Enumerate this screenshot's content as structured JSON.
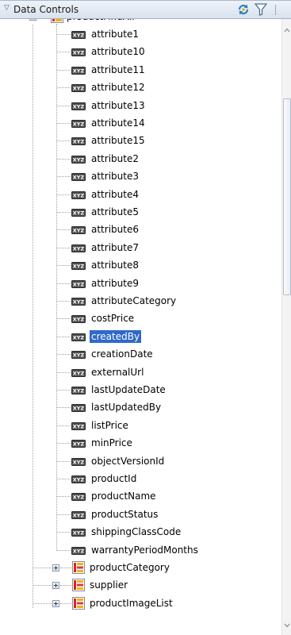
{
  "panel": {
    "title": "Data Controls"
  },
  "colors": {
    "selection": "#3069c8",
    "header": "#d9e2ee"
  },
  "icons": {
    "expand": "triangle-down-icon",
    "refresh": "refresh-icon",
    "filter": "filter-icon",
    "collection": "collection-icon",
    "attribute": "attribute-icon"
  },
  "attr_icon_text": "XYZ",
  "tree": {
    "root": {
      "label": "productFindAll",
      "expanded": true
    },
    "attributes": [
      "attribute1",
      "attribute10",
      "attribute11",
      "attribute12",
      "attribute13",
      "attribute14",
      "attribute15",
      "attribute2",
      "attribute3",
      "attribute4",
      "attribute5",
      "attribute6",
      "attribute7",
      "attribute8",
      "attribute9",
      "attributeCategory",
      "costPrice",
      "createdBy",
      "creationDate",
      "externalUrl",
      "lastUpdateDate",
      "lastUpdatedBy",
      "listPrice",
      "minPrice",
      "objectVersionId",
      "productId",
      "productName",
      "productStatus",
      "shippingClassCode",
      "warrantyPeriodMonths"
    ],
    "selected_index": 17,
    "collections": [
      "productCategory",
      "supplier",
      "productImageList"
    ]
  }
}
